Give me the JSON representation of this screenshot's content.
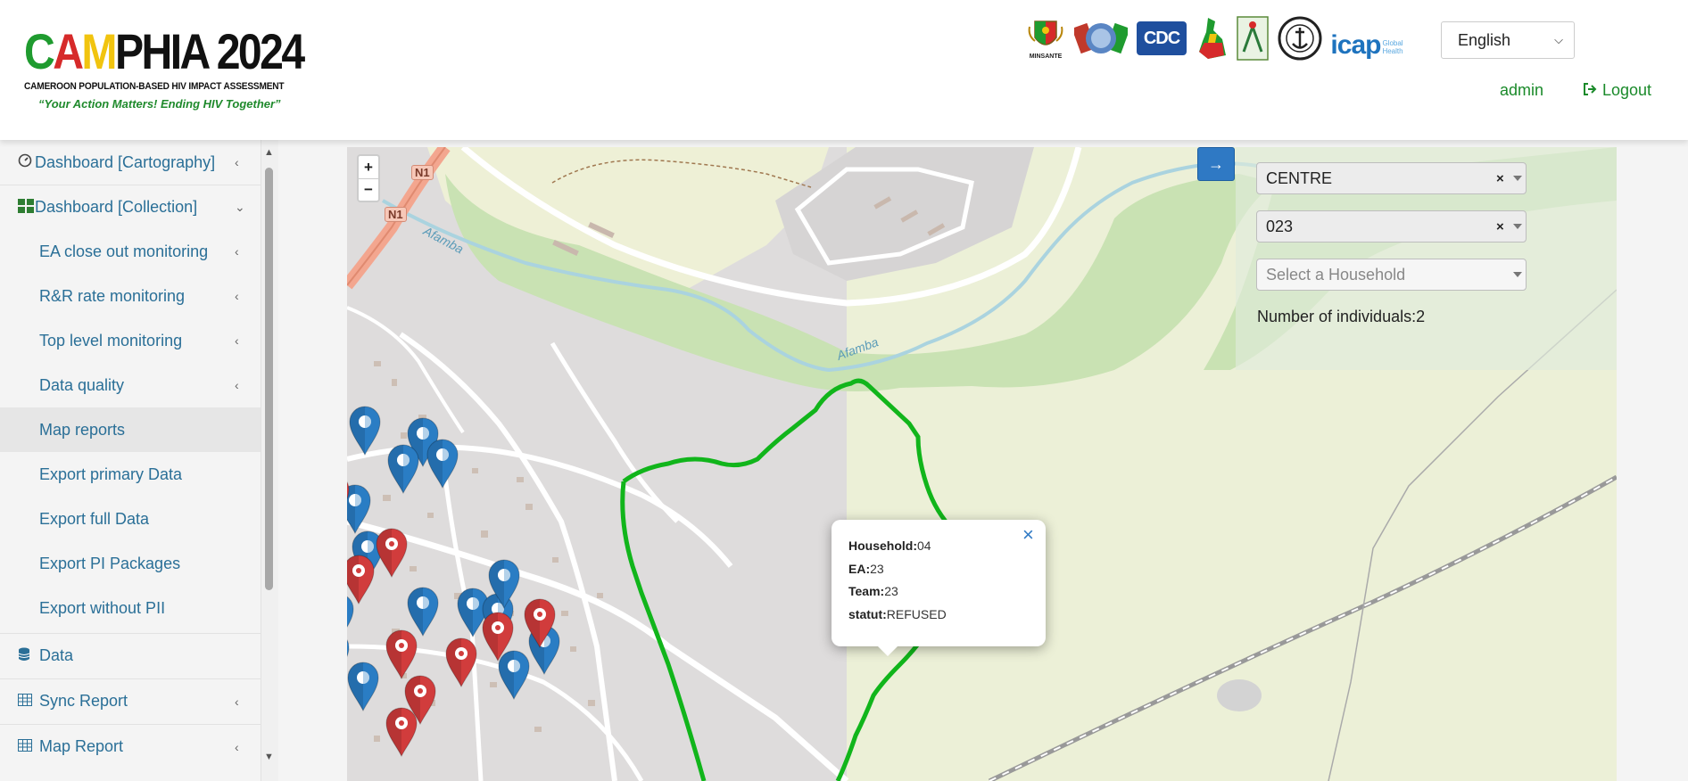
{
  "brand": {
    "title_parts": [
      "C",
      "A",
      "M",
      "PHIA 2024"
    ],
    "subtitle": "CAMEROON POPULATION-BASED HIV IMPACT ASSESSMENT",
    "slogan": "“Your Action Matters! Ending HIV Together”",
    "colors": {
      "green": "#1f9b2f",
      "red": "#d62a2a",
      "yellow": "#f1c40f"
    }
  },
  "header": {
    "partner_logos": [
      "minsante-coat-of-arms-icon",
      "pepfar-icon",
      "cdc-logo",
      "cameroon-map-flag-icon",
      "cnls-icon",
      "ministry-seal-icon",
      "icap-logo"
    ],
    "minsante_label": "MINSANTE",
    "cdc_label": "CDC",
    "icap_label": "icap",
    "icap_sub": "Global Health",
    "language": {
      "selected": "English"
    },
    "user": "admin",
    "logout": "Logout"
  },
  "sidebar": {
    "items": [
      {
        "label": "Dashboard [Cartography]",
        "icon": "dashboard-gauge-icon",
        "chevron": "chevron-left-icon"
      },
      {
        "label": "Dashboard [Collection]",
        "icon": "grid-icon",
        "chevron": "chevron-down-icon"
      },
      {
        "label": "EA close out monitoring",
        "chevron": "chevron-left-icon"
      },
      {
        "label": "R&R rate monitoring",
        "chevron": "chevron-left-icon"
      },
      {
        "label": "Top level monitoring",
        "chevron": "chevron-left-icon"
      },
      {
        "label": "Data quality",
        "chevron": "chevron-left-icon"
      },
      {
        "label": "Map reports",
        "active": true
      },
      {
        "label": "Export primary Data"
      },
      {
        "label": "Export full Data"
      },
      {
        "label": "Export PI Packages"
      },
      {
        "label": "Export without PII"
      },
      {
        "label": "Data",
        "icon": "database-icon"
      },
      {
        "label": "Sync Report",
        "icon": "table-icon",
        "chevron": "chevron-left-icon"
      },
      {
        "label": "Map Report",
        "icon": "table-icon",
        "chevron": "chevron-left-icon"
      }
    ]
  },
  "map": {
    "zoom_in": "+",
    "zoom_out": "−",
    "road_labels": [
      "N1",
      "N1"
    ],
    "river_labels": [
      "Afamba",
      "Afamba"
    ],
    "filters": {
      "region": "CENTRE",
      "ea": "023",
      "household_placeholder": "Select a Household",
      "individuals_label": "Number of individuals:",
      "individuals_count": "2"
    },
    "popup": {
      "household_label": "Household:",
      "household_value": "04",
      "ea_label": "EA:",
      "ea_value": "23",
      "team_label": "Team:",
      "team_value": "23",
      "status_label": "statut:",
      "status_value": "REFUSED"
    },
    "marker_colors": {
      "refused": "#d13c3c",
      "other": "#2a7dc4"
    }
  }
}
